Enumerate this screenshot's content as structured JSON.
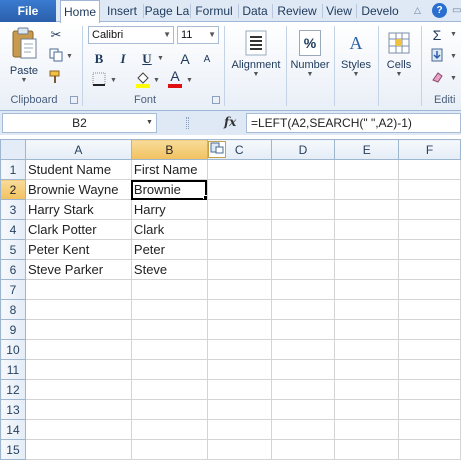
{
  "tabs": {
    "file": "File",
    "items": [
      "Home",
      "Insert",
      "Page La",
      "Formul",
      "Data",
      "Review",
      "View",
      "Develo"
    ],
    "active_index": 0
  },
  "ribbon": {
    "clipboard": {
      "paste_label": "Paste",
      "group_label": "Clipboard"
    },
    "font": {
      "font_name": "Calibri",
      "font_size": "11",
      "bold": "B",
      "italic": "I",
      "underline": "U",
      "group_label": "Font",
      "grow": "A",
      "shrink": "A",
      "font_color_letter": "A"
    },
    "alignment": {
      "label": "Alignment"
    },
    "number": {
      "label": "Number",
      "icon_text": "%"
    },
    "styles": {
      "label": "Styles",
      "icon_text": "A"
    },
    "cells": {
      "label": "Cells"
    },
    "editing": {
      "label": "Editi",
      "sum_icon": "Σ"
    }
  },
  "formula_bar": {
    "name_box": "B2",
    "fx": "fx",
    "formula": "=LEFT(A2,SEARCH(\" \",A2)-1)"
  },
  "columns": [
    "A",
    "B",
    "C",
    "D",
    "E",
    "F"
  ],
  "selected_column": "B",
  "selected_row": 2,
  "rows": [
    {
      "num": "1",
      "cells": [
        "Student Name",
        "First Name",
        "",
        "",
        "",
        ""
      ]
    },
    {
      "num": "2",
      "cells": [
        "Brownie Wayne",
        "Brownie",
        "",
        "",
        "",
        ""
      ]
    },
    {
      "num": "3",
      "cells": [
        "Harry Stark",
        "Harry",
        "",
        "",
        "",
        ""
      ]
    },
    {
      "num": "4",
      "cells": [
        "Clark Potter",
        "Clark",
        "",
        "",
        "",
        ""
      ]
    },
    {
      "num": "5",
      "cells": [
        "Peter Kent",
        "Peter",
        "",
        "",
        "",
        ""
      ]
    },
    {
      "num": "6",
      "cells": [
        "Steve Parker",
        "Steve",
        "",
        "",
        "",
        ""
      ]
    },
    {
      "num": "7",
      "cells": [
        "",
        "",
        "",
        "",
        "",
        ""
      ]
    },
    {
      "num": "8",
      "cells": [
        "",
        "",
        "",
        "",
        "",
        ""
      ]
    },
    {
      "num": "9",
      "cells": [
        "",
        "",
        "",
        "",
        "",
        ""
      ]
    },
    {
      "num": "10",
      "cells": [
        "",
        "",
        "",
        "",
        "",
        ""
      ]
    },
    {
      "num": "11",
      "cells": [
        "",
        "",
        "",
        "",
        "",
        ""
      ]
    },
    {
      "num": "12",
      "cells": [
        "",
        "",
        "",
        "",
        "",
        ""
      ]
    },
    {
      "num": "13",
      "cells": [
        "",
        "",
        "",
        "",
        "",
        ""
      ]
    },
    {
      "num": "14",
      "cells": [
        "",
        "",
        "",
        "",
        "",
        ""
      ]
    },
    {
      "num": "15",
      "cells": [
        "",
        "",
        "",
        "",
        "",
        ""
      ]
    }
  ],
  "colors": {
    "file_tab": "#2a5fab",
    "selected_header": "#f1c15f",
    "header_bg": "#e4ecf7",
    "font_color_bar": "#e01010",
    "highlight_bar": "#ffff00"
  }
}
